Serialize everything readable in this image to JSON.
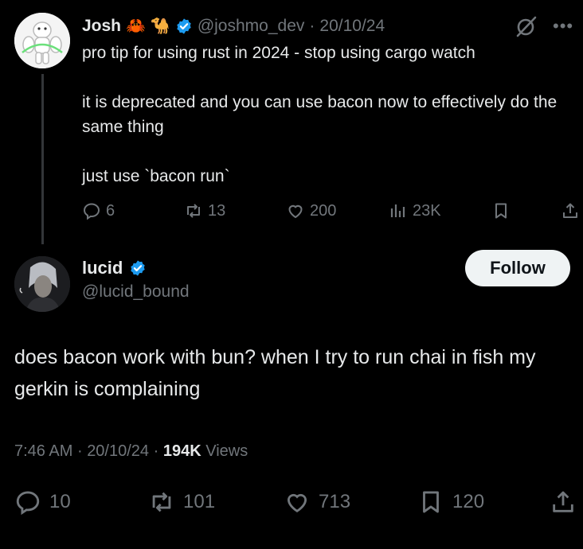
{
  "parent_tweet": {
    "author_name": "Josh",
    "name_emojis": [
      "🦀",
      "🐪"
    ],
    "handle": "@joshmo_dev",
    "separator": "·",
    "date": "20/10/24",
    "paragraphs": [
      "pro tip for using rust in 2024 - stop using cargo watch",
      "it is deprecated and you can use bacon now to effectively do the same thing",
      "just use `bacon run`"
    ],
    "stats": {
      "replies": "6",
      "reposts": "13",
      "likes": "200",
      "views": "23K"
    }
  },
  "reply_tweet": {
    "author_name": "lucid",
    "handle": "@lucid_bound",
    "follow_label": "Follow",
    "text": "does bacon work with bun? when I try to run chai in fish my gerkin is complaining",
    "time": "7:46 AM",
    "separator": "·",
    "date": "20/10/24",
    "views_count": "194K",
    "views_label": "Views",
    "stats": {
      "replies": "10",
      "reposts": "101",
      "likes": "713",
      "bookmarks": "120"
    }
  },
  "colors": {
    "background": "#000000",
    "text": "#e7e9ea",
    "muted": "#71767b",
    "verified": "#1d9bf0",
    "follow_bg": "#eff3f4"
  },
  "icons": [
    "verified-badge-icon",
    "grok-icon",
    "more-icon",
    "reply-icon",
    "repost-icon",
    "like-icon",
    "views-icon",
    "bookmark-icon",
    "share-icon"
  ]
}
